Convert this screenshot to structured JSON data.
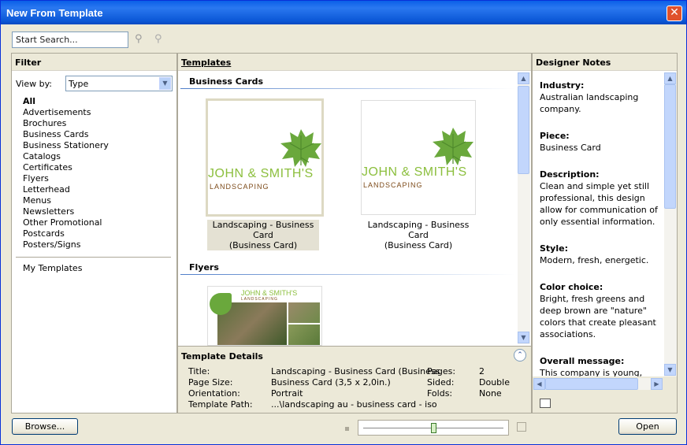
{
  "window": {
    "title": "New From Template"
  },
  "search": {
    "placeholder": "Start Search..."
  },
  "filter": {
    "header": "Filter",
    "view_by_label": "View by:",
    "view_by_value": "Type",
    "items": [
      "All",
      "Advertisements",
      "Brochures",
      "Business Cards",
      "Business Stationery",
      "Catalogs",
      "Certificates",
      "Flyers",
      "Letterhead",
      "Menus",
      "Newsletters",
      "Other Promotional",
      "Postcards",
      "Posters/Signs"
    ],
    "my_templates": "My Templates"
  },
  "templates": {
    "header": "Templates",
    "sections": [
      {
        "title": "Business Cards",
        "items": [
          {
            "line1": "Landscaping - Business Card",
            "line2": "(Business Card)",
            "selected": true
          },
          {
            "line1": "Landscaping - Business Card",
            "line2": "(Business Card)",
            "selected": false
          }
        ]
      },
      {
        "title": "Flyers"
      }
    ],
    "card_name": "JOHN & SMITH'S",
    "card_sub": "LANDSCAPING",
    "flyer_name": "JOHN & SMITH'S",
    "flyer_sub": "LANDSCAPING"
  },
  "details": {
    "header": "Template Details",
    "title_label": "Title:",
    "title_value": "Landscaping - Business Card (Business",
    "pagesize_label": "Page Size:",
    "pagesize_value": "Business Card (3,5 x 2,0in.)",
    "orientation_label": "Orientation:",
    "orientation_value": "Portrait",
    "path_label": "Template Path:",
    "path_value": "...\\landscaping au - business card - iso",
    "pages_label": "Pages:",
    "pages_value": "2",
    "sided_label": "Sided:",
    "sided_value": "Double",
    "folds_label": "Folds:",
    "folds_value": "None"
  },
  "notes": {
    "header": "Designer Notes",
    "industry_h": "Industry:",
    "industry": "Australian landscaping company.",
    "piece_h": "Piece:",
    "piece": "Business Card",
    "description_h": "Description:",
    "description": "Clean and simple yet still professional, this design allow for communication of only essential information.",
    "style_h": "Style:",
    "style": "Modern, fresh, energetic.",
    "color_h": "Color choice:",
    "color": "Bright, fresh greens and deep brown are \"nature\" colors that create pleasant associations.",
    "message_h": "Overall message:",
    "message": "This company is young, energetic and professional."
  },
  "buttons": {
    "browse": "Browse...",
    "open": "Open"
  },
  "zoom": {
    "level": 0.5
  },
  "colors": {
    "accent": "#8cbf3e",
    "brown": "#7d4b1a",
    "titlebar": "#0a5fe8"
  }
}
